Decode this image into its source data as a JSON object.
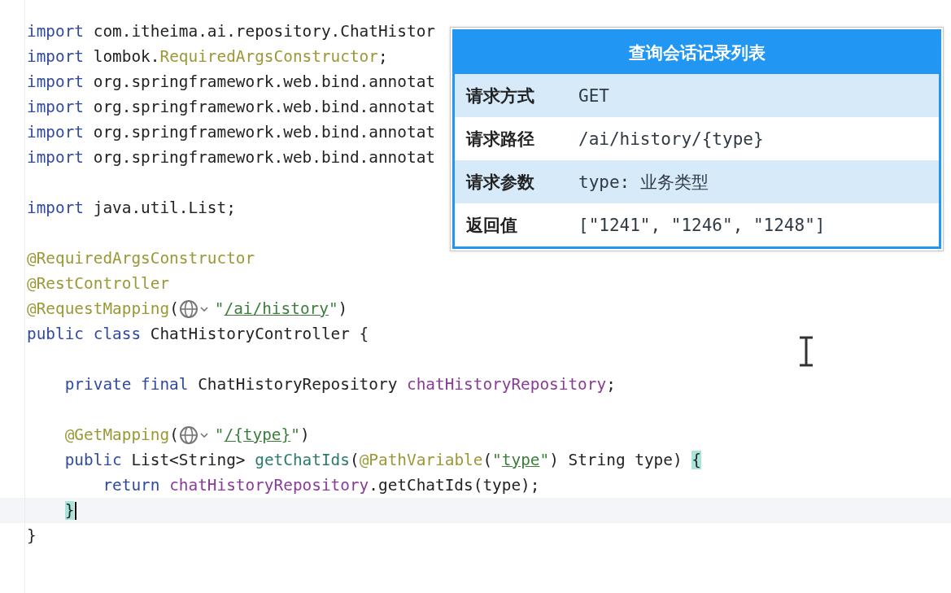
{
  "editor": {
    "lines": [
      {
        "current": false,
        "tokens": [
          {
            "kind": "keyword",
            "text": "import"
          },
          {
            "kind": "plain",
            "text": " com.itheima.ai.repository.ChatHistor"
          }
        ]
      },
      {
        "current": false,
        "tokens": [
          {
            "kind": "keyword",
            "text": "import"
          },
          {
            "kind": "plain",
            "text": " lombok."
          },
          {
            "kind": "annotation",
            "text": "RequiredArgsConstructor"
          },
          {
            "kind": "plain",
            "text": ";"
          }
        ]
      },
      {
        "current": false,
        "tokens": [
          {
            "kind": "keyword",
            "text": "import"
          },
          {
            "kind": "plain",
            "text": " org.springframework.web.bind.annotat"
          }
        ]
      },
      {
        "current": false,
        "tokens": [
          {
            "kind": "keyword",
            "text": "import"
          },
          {
            "kind": "plain",
            "text": " org.springframework.web.bind.annotat"
          }
        ]
      },
      {
        "current": false,
        "tokens": [
          {
            "kind": "keyword",
            "text": "import"
          },
          {
            "kind": "plain",
            "text": " org.springframework.web.bind.annotat"
          }
        ]
      },
      {
        "current": false,
        "tokens": [
          {
            "kind": "keyword",
            "text": "import"
          },
          {
            "kind": "plain",
            "text": " org.springframework.web.bind.annotat"
          }
        ]
      },
      {
        "current": false
      },
      {
        "current": false,
        "tokens": [
          {
            "kind": "keyword",
            "text": "import"
          },
          {
            "kind": "plain",
            "text": " java.util.List;"
          }
        ]
      },
      {
        "current": false
      },
      {
        "current": false,
        "tokens": [
          {
            "kind": "annotation",
            "text": "@RequiredArgsConstructor"
          }
        ]
      },
      {
        "current": false,
        "tokens": [
          {
            "kind": "annotation",
            "text": "@RestController"
          }
        ]
      },
      {
        "current": false,
        "tokens": [
          {
            "kind": "annotation",
            "text": "@RequestMapping"
          },
          {
            "kind": "plain",
            "text": "("
          },
          {
            "kind": "inlay"
          },
          {
            "kind": "string",
            "text": "\""
          },
          {
            "kind": "link",
            "text": "/ai/history"
          },
          {
            "kind": "string",
            "text": "\""
          },
          {
            "kind": "plain",
            "text": ")"
          }
        ]
      },
      {
        "current": false,
        "tokens": [
          {
            "kind": "keyword",
            "text": "public class"
          },
          {
            "kind": "plain",
            "text": " ChatHistoryController {"
          }
        ]
      },
      {
        "current": false
      },
      {
        "current": false,
        "tokens": [
          {
            "kind": "keyword",
            "text": "    private final"
          },
          {
            "kind": "plain",
            "text": " ChatHistoryRepository "
          },
          {
            "kind": "field",
            "text": "chatHistoryRepository"
          },
          {
            "kind": "plain",
            "text": ";"
          }
        ]
      },
      {
        "current": false
      },
      {
        "current": false,
        "tokens": [
          {
            "kind": "annotation",
            "text": "    @GetMapping"
          },
          {
            "kind": "plain",
            "text": "("
          },
          {
            "kind": "inlay"
          },
          {
            "kind": "string",
            "text": "\""
          },
          {
            "kind": "link",
            "text": "/{type}"
          },
          {
            "kind": "string",
            "text": "\""
          },
          {
            "kind": "plain",
            "text": ")"
          }
        ]
      },
      {
        "current": false,
        "tokens": [
          {
            "kind": "keyword",
            "text": "    public"
          },
          {
            "kind": "plain",
            "text": " List<String> "
          },
          {
            "kind": "method",
            "text": "getChatIds"
          },
          {
            "kind": "plain",
            "text": "("
          },
          {
            "kind": "annotation",
            "text": "@PathVariable"
          },
          {
            "kind": "plain",
            "text": "("
          },
          {
            "kind": "string",
            "text": "\""
          },
          {
            "kind": "link",
            "text": "type"
          },
          {
            "kind": "string",
            "text": "\""
          },
          {
            "kind": "plain",
            "text": ") String type) "
          },
          {
            "kind": "brace_match",
            "text": "{"
          }
        ]
      },
      {
        "current": false,
        "tokens": [
          {
            "kind": "keyword",
            "text": "        return "
          },
          {
            "kind": "field",
            "text": "chatHistoryRepository"
          },
          {
            "kind": "plain",
            "text": ".getChatIds(type);"
          }
        ]
      },
      {
        "current": true,
        "tokens": [
          {
            "kind": "brace_match",
            "text": "    }"
          }
        ]
      },
      {
        "current": false,
        "tokens": [
          {
            "kind": "plain",
            "text": "}"
          }
        ]
      }
    ]
  },
  "popup": {
    "title": "查询会话记录列表",
    "rows": [
      {
        "label": "请求方式",
        "value": "GET"
      },
      {
        "label": "请求路径",
        "value": "/ai/history/{type}"
      },
      {
        "label": "请求参数",
        "value": "type: 业务类型"
      },
      {
        "label": "返回值",
        "value": "[\"1241\", \"1246\", \"1248\"]"
      }
    ]
  }
}
